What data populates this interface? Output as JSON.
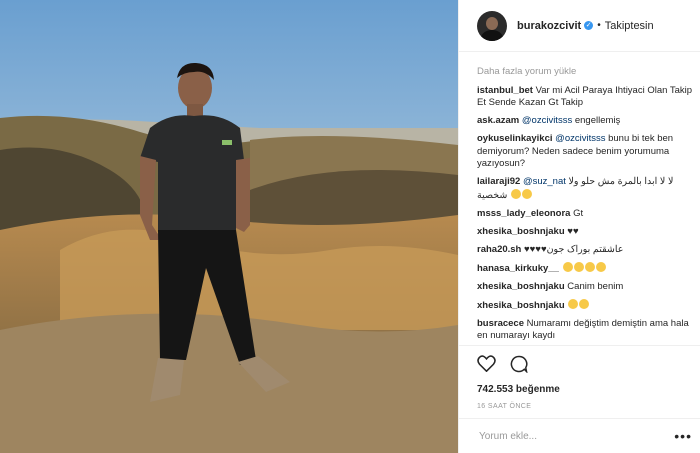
{
  "post": {
    "image_alt": "Man in dark t-shirt standing on grassy hill at sunset"
  },
  "header": {
    "username": "burakozcivit",
    "follow_status": "Takiptesin",
    "separator": "•"
  },
  "comments": {
    "load_more": "Daha fazla yorum yükle",
    "items": [
      {
        "user": "istanbul_bet",
        "text": "Var mi Acil Paraya Ihtiyaci Olan Takip Et Sende Kazan Gt Takip"
      },
      {
        "user": "ask.azam",
        "mention": "@ozcivitsss",
        "text": " engellemiş"
      },
      {
        "user": "oykuselinkayikci",
        "mention": "@ozcivitsss",
        "text": " bunu bi tek ben demiyorum? Neden sadece benim yorumuma yazıyosun?"
      },
      {
        "user": "lailaraji92",
        "mention": "@suz_nat",
        "text": "لا لا ابدا بالمرة مش حلو ولا شخصية"
      },
      {
        "user": "msss_lady_eleonora",
        "text": "Gt"
      },
      {
        "user": "xhesika_boshnjaku",
        "text": "♥♥"
      },
      {
        "user": "raha20.sh",
        "text": "عاشقتم بوراک جون♥♥♥♥"
      },
      {
        "user": "hanasa_kirkuky__",
        "text": ""
      },
      {
        "user": "xhesika_boshnjaku",
        "text": "Canim benim"
      },
      {
        "user": "xhesika_boshnjaku",
        "text": ""
      },
      {
        "user": "busracece",
        "text": "Numaramı değiştim demiştin ama hala en numarayı kaydı"
      }
    ]
  },
  "actions": {
    "likes": "742.553 beğenme",
    "time": "16 SAAT ÖNCE"
  },
  "composer": {
    "placeholder": "Yorum ekle...",
    "more": "•••"
  },
  "colors": {
    "verified": "#3897f0",
    "mention": "#003569",
    "muted": "#999999"
  }
}
